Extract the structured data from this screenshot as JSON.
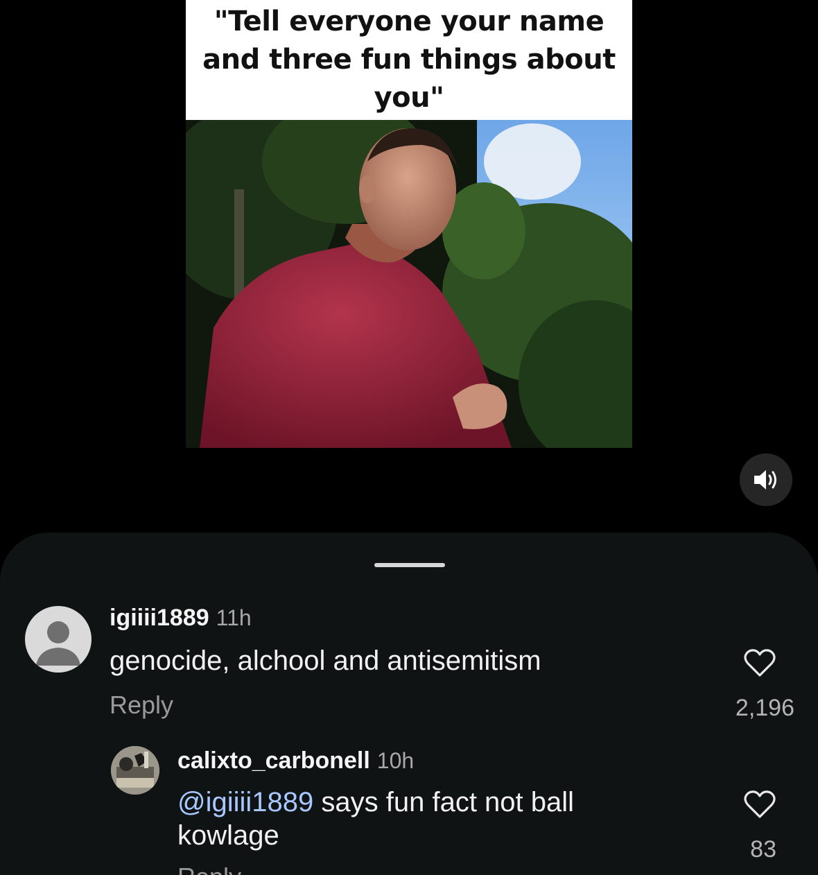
{
  "post": {
    "caption": "\"Tell everyone your name and three fun things about you\""
  },
  "comments": [
    {
      "username": "igiiii1889",
      "time": "11h",
      "text": "genocide, alchool and antisemitism",
      "reply_label": "Reply",
      "like_count": "2,196"
    },
    {
      "username": "calixto_carbonell",
      "time": "10h",
      "mention": "@igiiii1889",
      "text_line1": " says fun fact not ball",
      "text_line2": "kowlage",
      "reply_label": "Reply",
      "like_count": "83"
    }
  ],
  "icons": {
    "mute": "speaker-on-icon",
    "like": "heart-outline-icon",
    "avatar_default": "default-avatar-icon"
  },
  "colors": {
    "background": "#000000",
    "sheet": "#0f1314",
    "mention": "#a8c8ff",
    "secondary_text": "#a8a8a8"
  }
}
